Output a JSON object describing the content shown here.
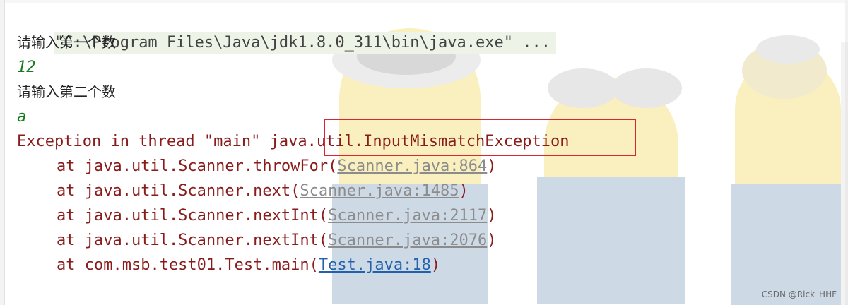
{
  "console": {
    "command": "\"C:\\Program Files\\Java\\jdk1.8.0_311\\bin\\java.exe\" ...",
    "prompt1": "请输入第一个数",
    "input1": "12",
    "prompt2": "请输入第二个数",
    "input2": "a",
    "exception": "Exception in thread \"main\" java.util.InputMismatchException",
    "stack": [
      {
        "prefix": "at java.util.Scanner.throwFor(",
        "link": "Scanner.java:864",
        "suffix": ")"
      },
      {
        "prefix": "at java.util.Scanner.next(",
        "link": "Scanner.java:1485",
        "suffix": ")"
      },
      {
        "prefix": "at java.util.Scanner.nextInt(",
        "link": "Scanner.java:2117",
        "suffix": ")"
      },
      {
        "prefix": "at java.util.Scanner.nextInt(",
        "link": "Scanner.java:2076",
        "suffix": ")"
      },
      {
        "prefix": "at com.msb.test01.Test.main(",
        "link": "Test.java:18",
        "suffix": ")"
      }
    ]
  },
  "watermark": "CSDN @Rick_HHF",
  "colors": {
    "error_text": "#8a1b1b",
    "input_text": "#137c1f",
    "link_gray": "#8c8c8c",
    "link_blue": "#2062ad",
    "highlight_border": "#d9262f"
  }
}
